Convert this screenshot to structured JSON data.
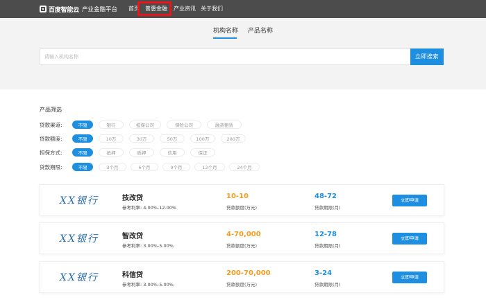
{
  "nav": {
    "logo_brand": "百度智能云",
    "logo_sub": "产业金融平台",
    "items": [
      "首页",
      "普惠金融",
      "产业资讯",
      "关于我们"
    ]
  },
  "search": {
    "tabs": [
      "机构名称",
      "产品名称"
    ],
    "active_tab": "机构名称",
    "placeholder": "请输入机构名称",
    "button": "立即搜索"
  },
  "filters": {
    "title": "产品筛选",
    "rows": [
      {
        "label": "贷款渠道:",
        "options": [
          "不限",
          "银行",
          "担保公司",
          "保险公司",
          "融资租赁"
        ]
      },
      {
        "label": "贷款额度:",
        "options": [
          "不限",
          "10万",
          "30万",
          "50万",
          "100万",
          "200万"
        ]
      },
      {
        "label": "担保方式:",
        "options": [
          "不限",
          "抵押",
          "质押",
          "信用",
          "保证"
        ]
      },
      {
        "label": "贷款期限:",
        "options": [
          "不限",
          "3个月",
          "6个月",
          "9个月",
          "12个月",
          "24个月"
        ]
      }
    ]
  },
  "products": [
    {
      "bank": "XX银行",
      "name": "技改贷",
      "rate": "参考利率: 4.00%-12.00%",
      "amount": "10-10",
      "amount_label": "贷款额度(万元)",
      "term": "48-72",
      "term_label": "贷款期限(月)",
      "apply": "立即申请"
    },
    {
      "bank": "XX银行",
      "name": "智改贷",
      "rate": "参考利率: 3.00%-5.00%",
      "amount": "4-70,000",
      "amount_label": "贷款额度(万元)",
      "term": "12-78",
      "term_label": "贷款期限(月)",
      "apply": "立即申请"
    },
    {
      "bank": "XX银行",
      "name": "科信贷",
      "rate": "参考利率: 3.00%-5.00%",
      "amount": "200-70,000",
      "amount_label": "贷款额度(万元)",
      "term": "3-24",
      "term_label": "贷款期限(月)",
      "apply": "立即申请"
    }
  ],
  "colors": {
    "accent": "#1e8fe0",
    "amount": "#f39c1f",
    "highlight": "#e8151b"
  }
}
